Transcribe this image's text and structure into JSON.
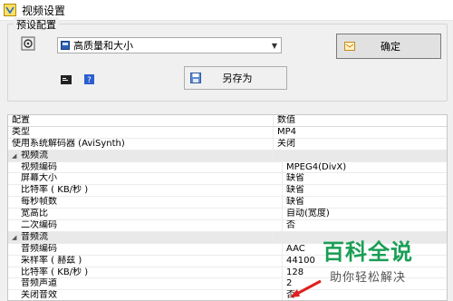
{
  "window": {
    "title": "视频设置"
  },
  "preset_group": {
    "legend": "预设配置",
    "preset_select": {
      "value": "高质量和大小"
    },
    "ok_button": {
      "label": "确定"
    },
    "saveas_button": {
      "label": "另存为"
    }
  },
  "table": {
    "columns": [
      "配置",
      "数值"
    ],
    "rows": [
      {
        "kind": "item",
        "name": "类型",
        "value": "MP4",
        "indent": false
      },
      {
        "kind": "item",
        "name": "使用系统解码器 (AviSynth)",
        "value": "关闭",
        "indent": false
      },
      {
        "kind": "section",
        "name": "视频流",
        "value": ""
      },
      {
        "kind": "item",
        "name": "视频编码",
        "value": "MPEG4(DivX)",
        "indent": true
      },
      {
        "kind": "item",
        "name": "屏幕大小",
        "value": "缺省",
        "indent": true
      },
      {
        "kind": "item",
        "name": "比特率 ( KB/秒 )",
        "value": "缺省",
        "indent": true
      },
      {
        "kind": "item",
        "name": "每秒帧数",
        "value": "缺省",
        "indent": true
      },
      {
        "kind": "item",
        "name": "宽高比",
        "value": "自动(宽度)",
        "indent": true
      },
      {
        "kind": "item",
        "name": "二次编码",
        "value": "否",
        "indent": true
      },
      {
        "kind": "section",
        "name": "音频流",
        "value": ""
      },
      {
        "kind": "item",
        "name": "音频编码",
        "value": "AAC",
        "indent": true
      },
      {
        "kind": "item",
        "name": "采样率 ( 赫兹 )",
        "value": "44100",
        "indent": true
      },
      {
        "kind": "item",
        "name": "比特率 ( KB/秒 )",
        "value": "128",
        "indent": true
      },
      {
        "kind": "item",
        "name": "音频声道",
        "value": "2",
        "indent": true
      },
      {
        "kind": "item",
        "name": "关闭音效",
        "value": "否",
        "indent": true
      }
    ]
  },
  "watermark": {
    "title": "百科全说",
    "subtitle": "助你轻松解决"
  },
  "colors": {
    "watermark_green": "#1a9e55",
    "arrow_red": "#e02020"
  }
}
